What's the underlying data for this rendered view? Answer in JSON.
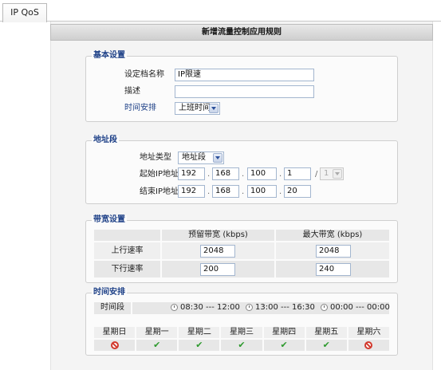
{
  "tab": {
    "label": "IP QoS"
  },
  "panel": {
    "title": "新增流量控制应用规则"
  },
  "basic": {
    "legend": "基本设置",
    "name_label": "设定档名称",
    "name_value": "IP限速",
    "desc_label": "描述",
    "desc_value": "",
    "schedule_label": "时间安排",
    "schedule_value": "上班时间"
  },
  "address": {
    "legend": "地址段",
    "type_label": "地址类型",
    "type_value": "地址段",
    "start_label": "起始IP地址",
    "start_ip": [
      "192",
      "168",
      "100",
      "1"
    ],
    "slash": "/",
    "mask_value": "1",
    "end_label": "结束IP地址",
    "end_ip": [
      "192",
      "168",
      "100",
      "20"
    ],
    "dot": "."
  },
  "bandwidth": {
    "legend": "带宽设置",
    "col_reserved": "预留带宽 (kbps)",
    "col_max": "最大带宽 (kbps)",
    "up_label": "上行速率",
    "up_reserved": "2048",
    "up_max": "2048",
    "down_label": "下行速率",
    "down_reserved": "200",
    "down_max": "240"
  },
  "schedule": {
    "legend": "时间安排",
    "period_label": "时间段",
    "periods": [
      "08:30 --- 12:00",
      "13:00 --- 16:30",
      "00:00 --- 00:00"
    ],
    "days": [
      "星期日",
      "星期一",
      "星期二",
      "星期三",
      "星期四",
      "星期五",
      "星期六"
    ],
    "day_enabled": [
      false,
      true,
      true,
      true,
      true,
      true,
      false
    ],
    "enabled_icon": "check-icon",
    "disabled_icon": "prohibited-icon",
    "enabled_color": "#2e9a2e",
    "disabled_color": "#d23a2e"
  },
  "colors": {
    "accent": "#1c3f86",
    "input_border": "#a3b6cf"
  }
}
